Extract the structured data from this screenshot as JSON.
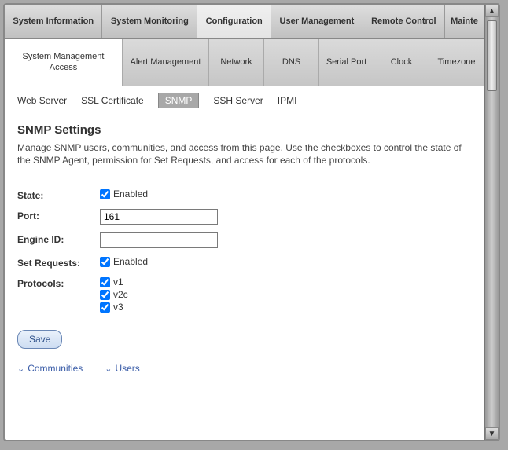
{
  "main_tabs": {
    "items": [
      {
        "label": "System Information"
      },
      {
        "label": "System Monitoring"
      },
      {
        "label": "Configuration",
        "active": true
      },
      {
        "label": "User Management"
      },
      {
        "label": "Remote Control"
      },
      {
        "label": "Mainte"
      }
    ]
  },
  "sub_tabs": {
    "items": [
      {
        "label": "System Management Access",
        "active": true
      },
      {
        "label": "Alert Management"
      },
      {
        "label": "Network"
      },
      {
        "label": "DNS"
      },
      {
        "label": "Serial Port"
      },
      {
        "label": "Clock"
      },
      {
        "label": "Timezone"
      }
    ]
  },
  "tertiary_tabs": {
    "items": [
      {
        "label": "Web Server"
      },
      {
        "label": "SSL Certificate"
      },
      {
        "label": "SNMP",
        "active": true
      },
      {
        "label": "SSH Server"
      },
      {
        "label": "IPMI"
      }
    ]
  },
  "page": {
    "heading": "SNMP Settings",
    "description": "Manage SNMP users, communities, and access from this page. Use the checkboxes to control the state of the SNMP Agent, permission for Set Requests, and access for each of the protocols."
  },
  "form": {
    "state_label": "State:",
    "state_enabled_label": "Enabled",
    "state_enabled_checked": true,
    "port_label": "Port:",
    "port_value": "161",
    "engine_label": "Engine ID:",
    "engine_value": "",
    "setreq_label": "Set Requests:",
    "setreq_enabled_label": "Enabled",
    "setreq_enabled_checked": true,
    "protocols_label": "Protocols:",
    "protocols": [
      {
        "label": "v1",
        "checked": true
      },
      {
        "label": "v2c",
        "checked": true
      },
      {
        "label": "v3",
        "checked": true
      }
    ],
    "save_label": "Save"
  },
  "expanders": {
    "communities_label": "Communities",
    "users_label": "Users"
  }
}
